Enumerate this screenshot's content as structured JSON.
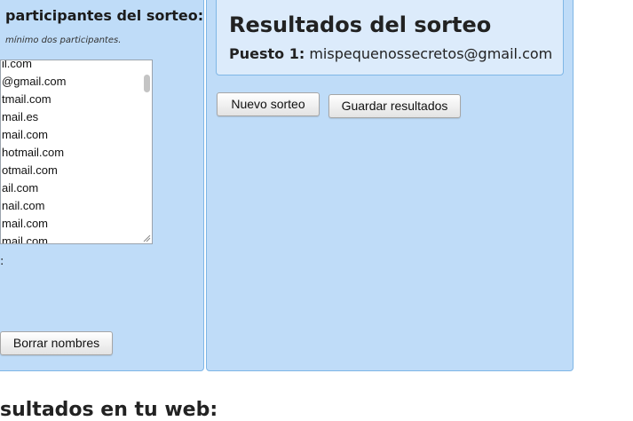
{
  "left_panel": {
    "title": "participantes del sorteo:",
    "hint": "mínimo dos participantes.",
    "participants": [
      "il.com",
      "@gmail.com",
      "tmail.com",
      "mail.es",
      "mail.com",
      "hotmail.com",
      "otmail.com",
      "ail.com",
      "nail.com",
      "mail.com",
      "mail.com"
    ],
    "colon_label": ":",
    "clear_button": "Borrar nombres"
  },
  "results": {
    "title": "Resultados del sorteo",
    "place_label": "Puesto 1:",
    "place_value": "mispequenossecretos@gmail.com"
  },
  "buttons": {
    "new_draw": "Nuevo sorteo",
    "save_results": "Guardar resultados"
  },
  "bottom_heading": "sultados en tu web:"
}
